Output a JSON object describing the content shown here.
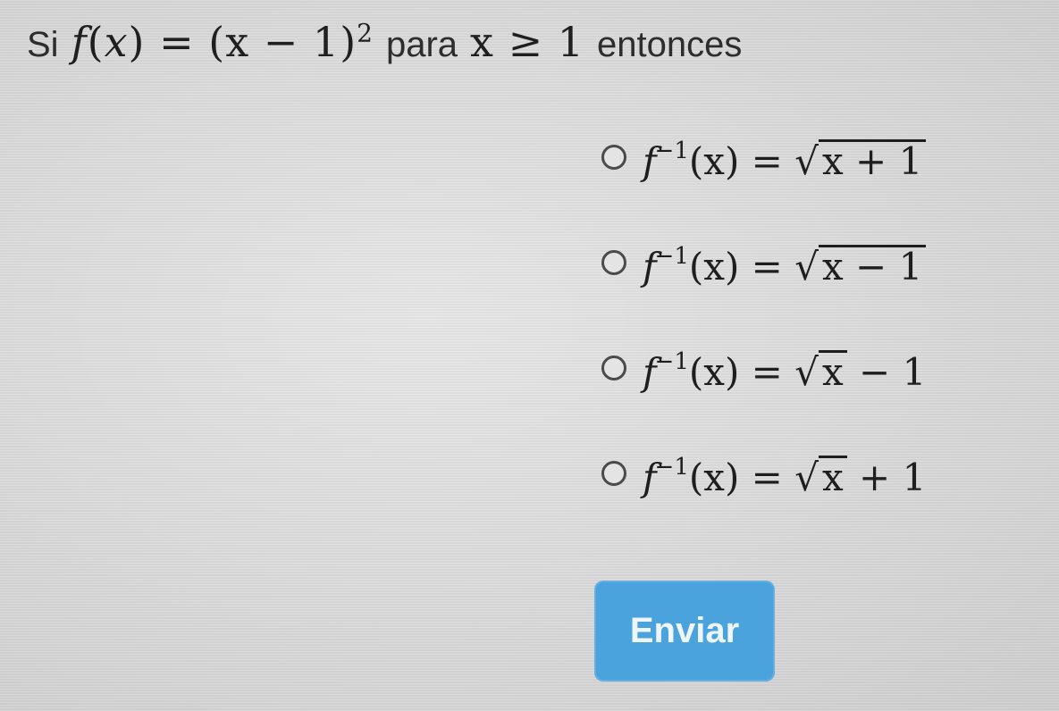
{
  "question": {
    "prefix": "Si",
    "function_name": "f",
    "variable": "x",
    "definition_rhs": "= (x − 1)",
    "exponent": "2",
    "middle": "para",
    "condition": "x ≥ 1",
    "suffix": "entonces"
  },
  "options": [
    {
      "lhs": "f",
      "sup": "−1",
      "arg": "(x) =",
      "radicand": "x + 1",
      "tail": ""
    },
    {
      "lhs": "f",
      "sup": "−1",
      "arg": "(x) =",
      "radicand": "x − 1",
      "tail": ""
    },
    {
      "lhs": "f",
      "sup": "−1",
      "arg": "(x) =",
      "radicand": "x",
      "tail": " − 1"
    },
    {
      "lhs": "f",
      "sup": "−1",
      "arg": "(x) =",
      "radicand": "x",
      "tail": " + 1"
    }
  ],
  "submit": {
    "label": "Enviar"
  },
  "colors": {
    "button": "#4aa3dc",
    "background": "#dedede",
    "text": "#2a2a2a"
  }
}
